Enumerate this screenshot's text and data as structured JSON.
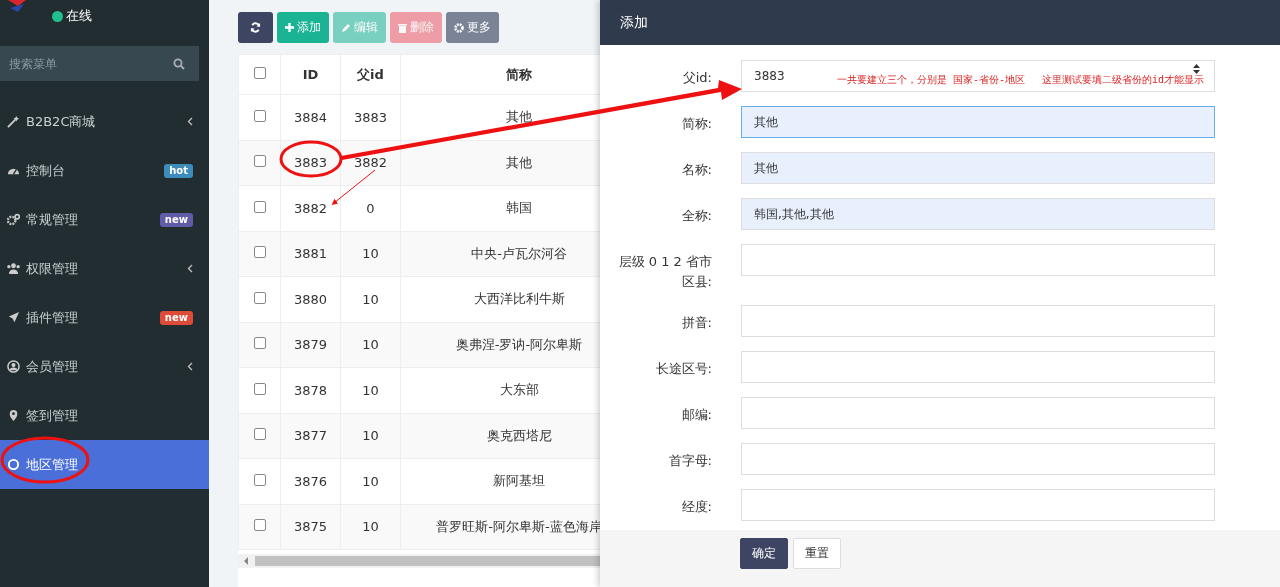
{
  "sidebar": {
    "status": "在线",
    "search_placeholder": "搜索菜单",
    "items": [
      {
        "label": "B2B2C商城",
        "has_submenu": true,
        "selected": false
      },
      {
        "label": "控制台",
        "badge": {
          "text": "hot",
          "color": "#3c8dbc"
        },
        "has_submenu": false,
        "selected": false
      },
      {
        "label": "常规管理",
        "badge": {
          "text": "new",
          "color": "#605ca8"
        },
        "has_submenu": false,
        "selected": false
      },
      {
        "label": "权限管理",
        "has_submenu": true,
        "selected": false
      },
      {
        "label": "插件管理",
        "badge": {
          "text": "new",
          "color": "#dd4b39"
        },
        "has_submenu": false,
        "selected": false
      },
      {
        "label": "会员管理",
        "has_submenu": true,
        "selected": false
      },
      {
        "label": "签到管理",
        "has_submenu": false,
        "selected": false
      },
      {
        "label": "地区管理",
        "has_submenu": false,
        "selected": true
      }
    ]
  },
  "toolbar": [
    {
      "kind": "refresh",
      "disabled": false
    },
    {
      "kind": "add",
      "label": "添加",
      "disabled": false
    },
    {
      "kind": "edit",
      "label": "编辑",
      "disabled": true
    },
    {
      "kind": "delete",
      "label": "删除",
      "disabled": true
    },
    {
      "kind": "more",
      "label": "更多",
      "disabled": false
    }
  ],
  "table": {
    "all_checked": false,
    "columns": [
      "ID",
      "父id",
      "简称"
    ],
    "rows": [
      {
        "cells": [
          "3884",
          "3883",
          "其他"
        ],
        "checked": false
      },
      {
        "cells": [
          "3883",
          "3882",
          "其他"
        ],
        "checked": false
      },
      {
        "cells": [
          "3882",
          "0",
          "韩国"
        ],
        "checked": false
      },
      {
        "cells": [
          "3881",
          "10",
          "中央-卢瓦尔河谷"
        ],
        "checked": false
      },
      {
        "cells": [
          "3880",
          "10",
          "大西洋比利牛斯"
        ],
        "checked": false
      },
      {
        "cells": [
          "3879",
          "10",
          "奥弗涅-罗讷-阿尔卑斯"
        ],
        "checked": false
      },
      {
        "cells": [
          "3878",
          "10",
          "大东部"
        ],
        "checked": false
      },
      {
        "cells": [
          "3877",
          "10",
          "奥克西塔尼"
        ],
        "checked": false
      },
      {
        "cells": [
          "3876",
          "10",
          "新阿基坦"
        ],
        "checked": false
      },
      {
        "cells": [
          "3875",
          "10",
          "普罗旺斯-阿尔卑斯-蓝色海岸"
        ],
        "checked": false
      }
    ]
  },
  "dialog": {
    "title": "添加",
    "fields": [
      {
        "label": "父id:",
        "value": "3883",
        "kind": "number",
        "autofilled": false,
        "focused": false
      },
      {
        "label": "简称:",
        "value": "其他",
        "kind": "text",
        "autofilled": true,
        "focused": true
      },
      {
        "label": "名称:",
        "value": "其他",
        "kind": "text",
        "autofilled": true,
        "focused": false
      },
      {
        "label": "全称:",
        "value": "韩国,其他,其他",
        "kind": "text",
        "autofilled": true,
        "focused": false
      },
      {
        "label": "层级 0 1 2 省市区县:",
        "kind": "text",
        "autofilled": false,
        "focused": false
      },
      {
        "label": "拼音:",
        "kind": "text",
        "autofilled": false,
        "focused": false
      },
      {
        "label": "长途区号:",
        "kind": "text",
        "autofilled": false,
        "focused": false
      },
      {
        "label": "邮编:",
        "kind": "text",
        "autofilled": false,
        "focused": false
      },
      {
        "label": "首字母:",
        "kind": "text",
        "autofilled": false,
        "focused": false
      },
      {
        "label": "经度:",
        "kind": "text",
        "autofilled": false,
        "focused": false
      }
    ],
    "notes": [
      "一共要建立三个，分别是 国家-省份-地区",
      "这里测试要填二级省份的id才能显示"
    ],
    "buttons": [
      {
        "label": "确定",
        "kind": "primary"
      },
      {
        "label": "重置",
        "kind": "default"
      }
    ]
  }
}
